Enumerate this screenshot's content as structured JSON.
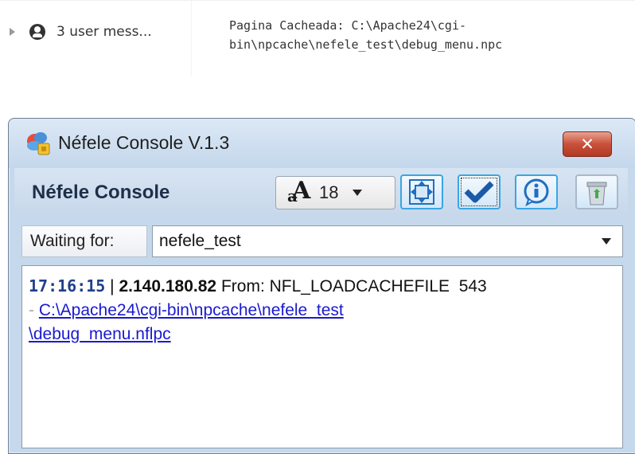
{
  "devtools": {
    "user_messages": "3 user mess...",
    "message_line1": "Pagina Cacheada: C:\\Apache24\\cgi-",
    "message_line2": "bin\\npcache\\nefele_test\\debug_menu.npc"
  },
  "window": {
    "title": "Néfele Console V.1.3",
    "close_label": "✕"
  },
  "toolbar": {
    "title": "Néfele Console",
    "font_size": "18",
    "icons": [
      "font-size-icon",
      "fit-window-icon",
      "checkmark-icon",
      "info-icon",
      "trash-icon"
    ]
  },
  "waiting": {
    "label": "Waiting for:",
    "value": "nefele_test"
  },
  "log": {
    "time": "17:16:15",
    "separator": "|",
    "ip": "2.140.180.82",
    "from": "From: NFL_LOADCACHEFILE",
    "count": "543",
    "dash": "-",
    "link_line1": "C:\\Apache24\\cgi-bin\\npcache\\nefele_test",
    "link_line2": "\\debug_menu.nflpc"
  },
  "colors": {
    "accent_border": "#39a6e3",
    "window_bg": "#c6d8ec",
    "close_red": "#c9503a",
    "link": "#1a1ad0",
    "timestamp": "#1f3f8a"
  }
}
